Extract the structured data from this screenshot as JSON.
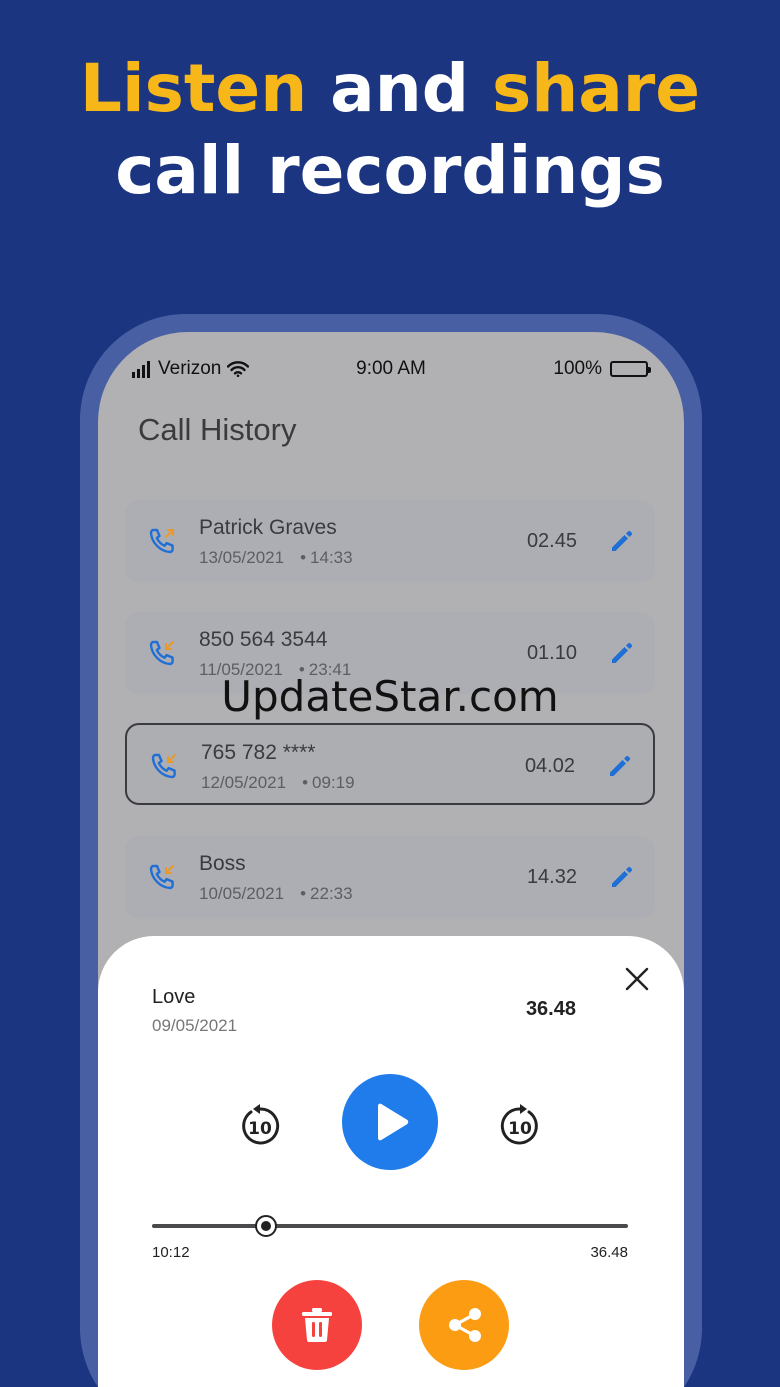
{
  "headline": {
    "word1": "Listen",
    "word2": "and",
    "word3": "share",
    "line2": "call recordings",
    "accent_color": "#f8b718"
  },
  "status_bar": {
    "carrier": "Verizon",
    "time": "9:00 AM",
    "battery": "100%"
  },
  "screen": {
    "title": "Call History"
  },
  "calls": [
    {
      "name": "Patrick Graves",
      "date": "13/05/2021",
      "time": "14:33",
      "duration": "02.45",
      "direction": "outgoing"
    },
    {
      "name": "850 564 3544",
      "date": "11/05/2021",
      "time": "23:41",
      "duration": "01.10",
      "direction": "incoming"
    },
    {
      "name": "765 782 ****",
      "date": "12/05/2021",
      "time": "09:19",
      "duration": "04.02",
      "direction": "incoming"
    },
    {
      "name": "Boss",
      "date": "10/05/2021",
      "time": "22:33",
      "duration": "14.32",
      "direction": "incoming"
    }
  ],
  "watermark": "UpdateStar.com",
  "player": {
    "title": "Love",
    "date": "09/05/2021",
    "duration": "36.48",
    "current_time": "10:12",
    "total_time": "36.48",
    "progress": 0.24,
    "replay_label": "10",
    "forward_label": "10",
    "play_color": "#1f7cea",
    "delete_color": "#f6423f",
    "share_color": "#fb9c12"
  }
}
